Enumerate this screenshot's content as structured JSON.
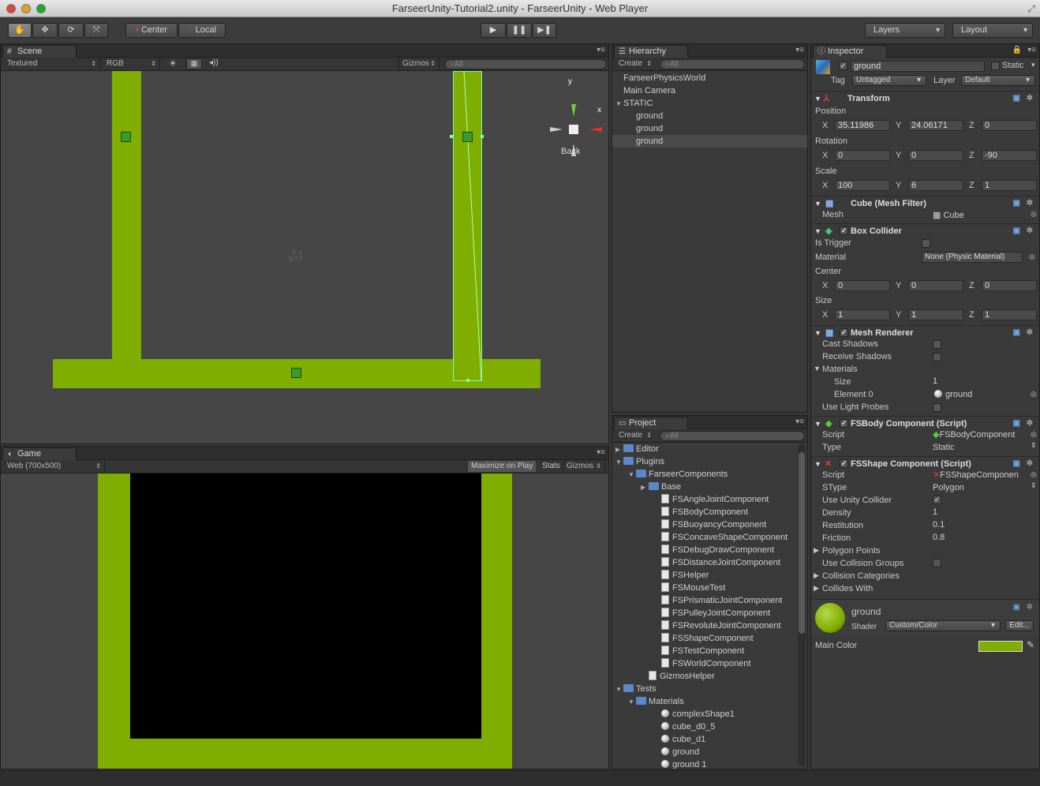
{
  "window": {
    "title": "FarseerUnity-Tutorial2.unity - FarseerUnity - Web Player"
  },
  "toolbar": {
    "center": "Center",
    "local": "Local",
    "layers": "Layers",
    "layout": "Layout"
  },
  "scene": {
    "tab": "Scene",
    "render_mode": "Textured",
    "color_mode": "RGB",
    "gizmos": "Gizmos",
    "search_placeholder": "All",
    "gizmo_y": "y",
    "gizmo_x": "x",
    "view_label": "Back"
  },
  "game": {
    "tab": "Game",
    "resolution": "Web (700x500)",
    "maximize": "Maximize on Play",
    "stats": "Stats",
    "gizmos": "Gizmos"
  },
  "hierarchy": {
    "tab": "Hierarchy",
    "create": "Create",
    "search": "All",
    "items": [
      {
        "label": "FarseerPhysicsWorld",
        "indent": 0
      },
      {
        "label": "Main Camera",
        "indent": 0
      },
      {
        "label": "STATIC",
        "indent": 0,
        "open": true
      },
      {
        "label": "ground",
        "indent": 1
      },
      {
        "label": "ground",
        "indent": 1
      },
      {
        "label": "ground",
        "indent": 1,
        "selected": true
      }
    ]
  },
  "project": {
    "tab": "Project",
    "create": "Create",
    "search": "All",
    "items": [
      {
        "label": "Editor",
        "type": "folder",
        "indent": 0,
        "arrow": "▶"
      },
      {
        "label": "Plugins",
        "type": "folder",
        "indent": 0,
        "arrow": "▼"
      },
      {
        "label": "FarseerComponents",
        "type": "folder",
        "indent": 1,
        "arrow": "▼"
      },
      {
        "label": "Base",
        "type": "folder",
        "indent": 2,
        "arrow": "▶"
      },
      {
        "label": "FSAngleJointComponent",
        "type": "file",
        "indent": 3
      },
      {
        "label": "FSBodyComponent",
        "type": "file",
        "indent": 3
      },
      {
        "label": "FSBuoyancyComponent",
        "type": "file",
        "indent": 3
      },
      {
        "label": "FSConcaveShapeComponent",
        "type": "file",
        "indent": 3
      },
      {
        "label": "FSDebugDrawComponent",
        "type": "file",
        "indent": 3
      },
      {
        "label": "FSDistanceJointComponent",
        "type": "file",
        "indent": 3
      },
      {
        "label": "FSHelper",
        "type": "file",
        "indent": 3
      },
      {
        "label": "FSMouseTest",
        "type": "file",
        "indent": 3
      },
      {
        "label": "FSPrismaticJointComponent",
        "type": "file",
        "indent": 3
      },
      {
        "label": "FSPulleyJointComponent",
        "type": "file",
        "indent": 3
      },
      {
        "label": "FSRevoluteJointComponent",
        "type": "file",
        "indent": 3
      },
      {
        "label": "FSShapeComponent",
        "type": "file",
        "indent": 3
      },
      {
        "label": "FSTestComponent",
        "type": "file",
        "indent": 3
      },
      {
        "label": "FSWorldComponent",
        "type": "file",
        "indent": 3
      },
      {
        "label": "GizmosHelper",
        "type": "file",
        "indent": 2
      },
      {
        "label": "Tests",
        "type": "folder",
        "indent": 0,
        "arrow": "▼"
      },
      {
        "label": "Materials",
        "type": "folder",
        "indent": 1,
        "arrow": "▼"
      },
      {
        "label": "complexShape1",
        "type": "mat",
        "indent": 3
      },
      {
        "label": "cube_d0_5",
        "type": "mat",
        "indent": 3
      },
      {
        "label": "cube_d1",
        "type": "mat",
        "indent": 3
      },
      {
        "label": "ground",
        "type": "mat",
        "indent": 3
      },
      {
        "label": "ground 1",
        "type": "mat",
        "indent": 3
      }
    ]
  },
  "inspector": {
    "tab": "Inspector",
    "name": "ground",
    "static": "Static",
    "tag_label": "Tag",
    "tag": "Untagged",
    "layer_label": "Layer",
    "layer": "Default",
    "transform": {
      "title": "Transform",
      "position": "Position",
      "rotation": "Rotation",
      "scale": "Scale",
      "x": "X",
      "y": "Y",
      "z": "Z",
      "pos": [
        "35.11986",
        "24.06171",
        "0"
      ],
      "rot": [
        "0",
        "0",
        "-90"
      ],
      "scl": [
        "100",
        "6",
        "1"
      ]
    },
    "mesh_filter": {
      "title": "Cube (Mesh Filter)",
      "mesh_label": "Mesh",
      "mesh": "Cube"
    },
    "box_collider": {
      "title": "Box Collider",
      "is_trigger": "Is Trigger",
      "material_label": "Material",
      "material": "None (Physic Material)",
      "center": "Center",
      "size": "Size",
      "center_v": [
        "0",
        "0",
        "0"
      ],
      "size_v": [
        "1",
        "1",
        "1"
      ]
    },
    "mesh_renderer": {
      "title": "Mesh Renderer",
      "cast": "Cast Shadows",
      "receive": "Receive Shadows",
      "materials": "Materials",
      "size_label": "Size",
      "size": "1",
      "element0_label": "Element 0",
      "element0": "ground",
      "light_probes": "Use Light Probes"
    },
    "fsbody": {
      "title": "FSBody Component (Script)",
      "script_label": "Script",
      "script": "FSBodyComponent",
      "type_label": "Type",
      "type": "Static"
    },
    "fsshape": {
      "title": "FSShape Component (Script)",
      "script_label": "Script",
      "script": "FSShapeComponen",
      "stype_label": "SType",
      "stype": "Polygon",
      "unity_collider": "Use Unity Collider",
      "density_label": "Density",
      "density": "1",
      "restitution_label": "Restitution",
      "restitution": "0.1",
      "friction_label": "Friction",
      "friction": "0.8",
      "polygon_points": "Polygon Points",
      "collision_groups": "Use Collision Groups",
      "collision_categories": "Collision Categories",
      "collides_with": "Collides With"
    },
    "material": {
      "name": "ground",
      "shader_label": "Shader",
      "shader": "Custom/Color",
      "edit": "Edit...",
      "main_color": "Main Color",
      "color": "#7fad00"
    }
  },
  "colors": {
    "ground": "#7fad00",
    "selection": "#7fff9f"
  }
}
